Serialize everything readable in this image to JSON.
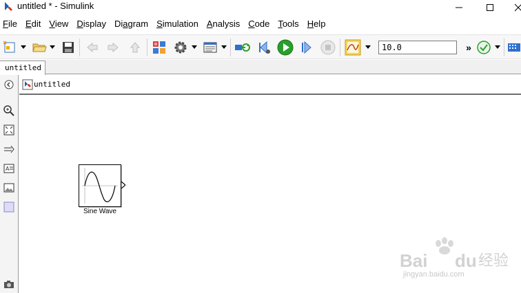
{
  "window": {
    "title": "untitled * - Simulink"
  },
  "menu": [
    {
      "accel": "F",
      "rest": "ile"
    },
    {
      "accel": "E",
      "rest": "dit"
    },
    {
      "accel": "V",
      "rest": "iew"
    },
    {
      "accel": "D",
      "rest": "isplay"
    },
    {
      "accel": "",
      "rest": "Diagram",
      "pre": "Di",
      "acc2": "a",
      "post": "gram"
    },
    {
      "accel": "S",
      "rest": "imulation"
    },
    {
      "accel": "A",
      "rest": "nalysis"
    },
    {
      "accel": "C",
      "rest": "ode"
    },
    {
      "accel": "T",
      "rest": "ools"
    },
    {
      "accel": "H",
      "rest": "elp"
    }
  ],
  "toolbar": {
    "stop_time": "10.0",
    "overflow": "»"
  },
  "tabs": [
    {
      "label": "untitled"
    }
  ],
  "explorer": {
    "path": "untitled"
  },
  "canvas": {
    "block_name": "Sine Wave"
  },
  "watermark": {
    "brand": "Baidu经验",
    "url": "jingyan.baidu.com"
  },
  "colors": {
    "run_green": "#2aa02a",
    "accent_blue": "#2f6fcf",
    "scope_orange": "#f0a020"
  }
}
